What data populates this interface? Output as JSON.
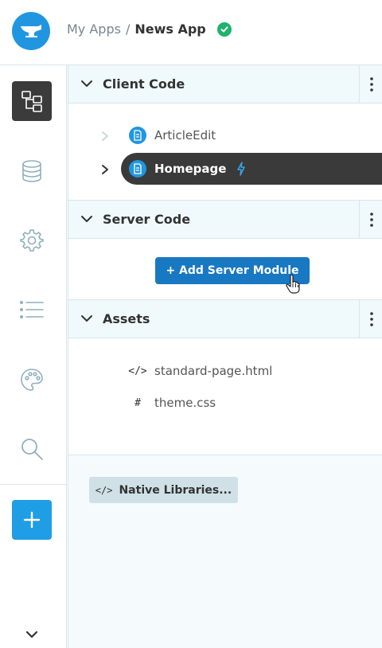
{
  "header": {
    "logo_icon": "anvil-logo-icon",
    "breadcrumb_parent": "My Apps",
    "breadcrumb_sep": "/",
    "breadcrumb_current": "News App",
    "status_icon": "check-circle-icon",
    "status_color": "#1fb36b"
  },
  "rail": {
    "items": [
      {
        "icon": "app-tree-icon",
        "active": true
      },
      {
        "icon": "database-icon"
      },
      {
        "icon": "settings-icon"
      },
      {
        "icon": "list-icon"
      },
      {
        "icon": "palette-icon"
      },
      {
        "icon": "search-icon"
      },
      {
        "icon": "plus-icon",
        "accent": "#1f9ee6"
      }
    ],
    "expand_icon": "chevron-down-icon"
  },
  "panel": {
    "client_code": {
      "title": "Client Code",
      "items": [
        {
          "label": "ArticleEdit",
          "selected": false
        },
        {
          "label": "Homepage",
          "selected": true
        }
      ]
    },
    "server_code": {
      "title": "Server Code",
      "add_button": "+ Add Server Module"
    },
    "assets": {
      "title": "Assets",
      "items": [
        {
          "icon": "</>",
          "label": "standard-page.html"
        },
        {
          "icon": "#",
          "label": "theme.css"
        }
      ]
    },
    "native_libraries": {
      "icon": "</>",
      "label": "Native Libraries..."
    }
  },
  "colors": {
    "brand_blue": "#2196e0",
    "button_blue": "#1978c2",
    "selected_bg": "#3a3a3a"
  }
}
